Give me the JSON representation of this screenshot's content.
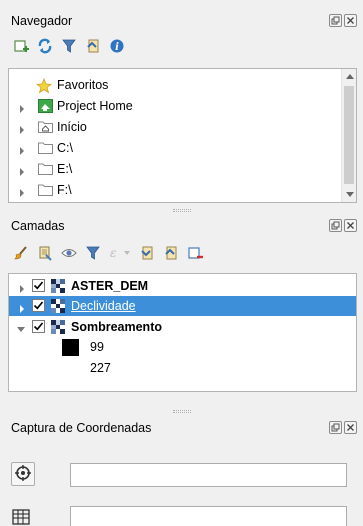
{
  "navigator": {
    "title": "Navegador",
    "toolbar": [
      "add-layer-icon",
      "refresh-icon",
      "filter-icon",
      "collapse-all-icon",
      "info-icon"
    ],
    "items": [
      {
        "label": "Favoritos",
        "icon": "star-icon"
      },
      {
        "label": "Project Home",
        "icon": "project-home-icon"
      },
      {
        "label": "Início",
        "icon": "home-folder-icon"
      },
      {
        "label": "C:\\",
        "icon": "folder-icon"
      },
      {
        "label": "E:\\",
        "icon": "folder-icon"
      },
      {
        "label": "F:\\",
        "icon": "folder-icon"
      }
    ]
  },
  "layers": {
    "title": "Camadas",
    "toolbar": [
      "style-brush-icon",
      "layer-select-icon",
      "visibility-eye-icon",
      "filter-icon",
      "expression-filter-icon",
      "expand-all-icon",
      "collapse-all-icon",
      "remove-layer-icon"
    ],
    "items": [
      {
        "label": "ASTER_DEM",
        "checked": true,
        "selected": false,
        "expanded": false
      },
      {
        "label": "Declividade",
        "checked": true,
        "selected": true,
        "expanded": false
      },
      {
        "label": "Sombreamento",
        "checked": true,
        "selected": false,
        "expanded": true
      }
    ],
    "legend": [
      {
        "label": "99",
        "color": "#000000"
      },
      {
        "label": "227",
        "color": "#ffffff"
      }
    ]
  },
  "coords": {
    "title": "Captura de Coordenadas",
    "row1_value": "",
    "row2_value": ""
  },
  "colors": {
    "selection": "#3c8fd8",
    "panel_bg": "#f0f0f0"
  }
}
